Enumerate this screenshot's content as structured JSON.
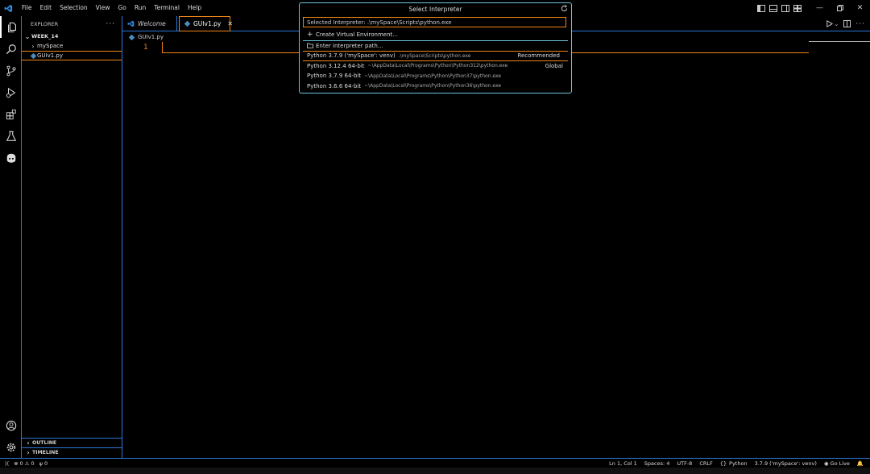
{
  "menu": [
    "File",
    "Edit",
    "Selection",
    "View",
    "Go",
    "Run",
    "Terminal",
    "Help"
  ],
  "sidebar": {
    "title": "EXPLORER",
    "folder": "WEEK_14",
    "items": [
      {
        "label": "mySpace",
        "type": "folder"
      },
      {
        "label": "GUIv1.py",
        "type": "file"
      }
    ],
    "outline": "OUTLINE",
    "timeline": "TIMELINE"
  },
  "tabs": [
    {
      "label": "Welcome",
      "active": false
    },
    {
      "label": "GUIv1.py",
      "active": true
    }
  ],
  "breadcrumb": "GUIv1.py",
  "editor": {
    "line_number": "1"
  },
  "quickpick": {
    "title": "Select Interpreter",
    "input_value": "Selected Interpreter: .\\mySpace\\Scripts\\python.exe",
    "actions": [
      {
        "label": "Create Virtual Environment..."
      },
      {
        "label": "Enter interpreter path..."
      }
    ],
    "interpreters": [
      {
        "label": "Python 3.7.9 ('mySpace': venv)",
        "path": ".\\mySpace\\Scripts\\python.exe",
        "tag": "Recommended"
      },
      {
        "label": "Python 3.12.4 64-bit",
        "path": "~\\AppData\\Local\\Programs\\Python\\Python312\\python.exe",
        "tag": "Global"
      },
      {
        "label": "Python 3.7.9 64-bit",
        "path": "~\\AppData\\Local\\Programs\\Python\\Python37\\python.exe",
        "tag": ""
      },
      {
        "label": "Python 3.6.6 64-bit",
        "path": "~\\AppData\\Local\\Programs\\Python\\Python36\\python.exe",
        "tag": ""
      }
    ]
  },
  "status": {
    "errors": "0",
    "warnings": "0",
    "ports": "0",
    "position": "Ln 1, Col 1",
    "spaces": "Spaces: 4",
    "encoding": "UTF-8",
    "eol": "CRLF",
    "language": "Python",
    "interpreter": "3.7.9 ('mySpace': venv)",
    "golive": "Go Live"
  },
  "colors": {
    "accent": "#f38518",
    "border": "#2b79d8",
    "vscode_blue": "#2f8de4",
    "python_blue": "#4b8bbe"
  }
}
